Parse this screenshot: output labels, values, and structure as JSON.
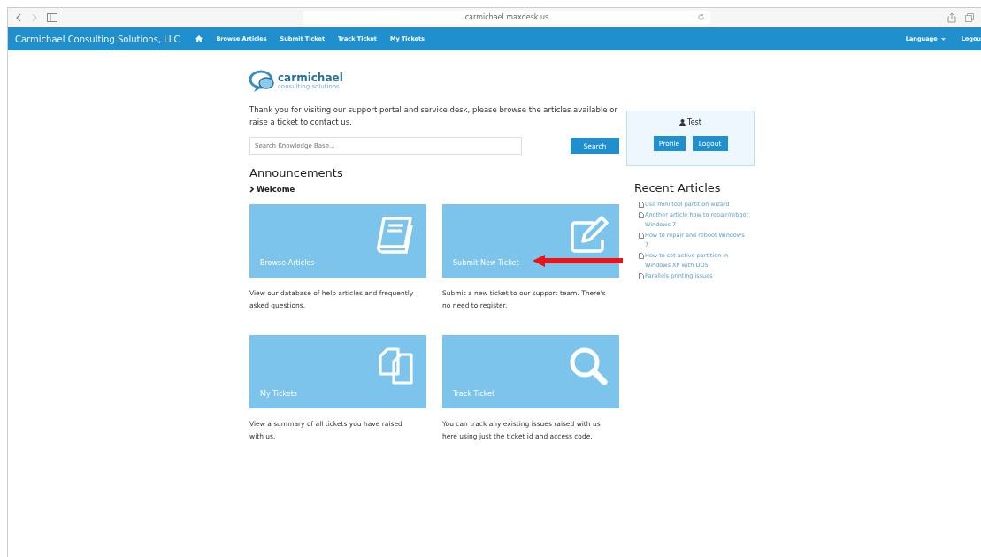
{
  "browser": {
    "address": "carmichael.maxdesk.us"
  },
  "navbar": {
    "brand": "Carmichael Consulting Solutions, LLC",
    "links": [
      "Browse Articles",
      "Submit Ticket",
      "Track Ticket",
      "My Tickets"
    ],
    "language": "Language",
    "logout": "Logou"
  },
  "logo": {
    "name": "carmichael",
    "tagline": "consulting solutions"
  },
  "intro": "Thank you for visiting our support portal and service desk, please browse the articles available or raise a ticket to contact us.",
  "search": {
    "placeholder": "Search Knowledge Base...",
    "button": "Search"
  },
  "announcements": {
    "title": "Announcements",
    "items": [
      "Welcome"
    ]
  },
  "tiles": [
    {
      "title": "Browse Articles",
      "text": "View our database of help articles and frequently asked questions.",
      "arrow": false
    },
    {
      "title": "Submit New Ticket",
      "text": "Submit a new ticket to our support team. There's no need to register.",
      "arrow": true
    },
    {
      "title": "My Tickets",
      "text": "View a summary of all tickets you have raised with us.",
      "arrow": false
    },
    {
      "title": "Track Ticket",
      "text": "You can track any existing issues raised with us here using just the ticket id and access code.",
      "arrow": false
    }
  ],
  "user": {
    "name": "Test",
    "buttons": [
      "Profile",
      "Logout"
    ]
  },
  "recent_articles": {
    "title": "Recent Articles",
    "items": [
      "Use mini tool partition wizard",
      "Another article how to repair/reboot Windows 7",
      "How to repair and reboot Windows 7",
      "How to set active partition in Windows XP with DOS",
      "Parallels printing issues"
    ]
  }
}
